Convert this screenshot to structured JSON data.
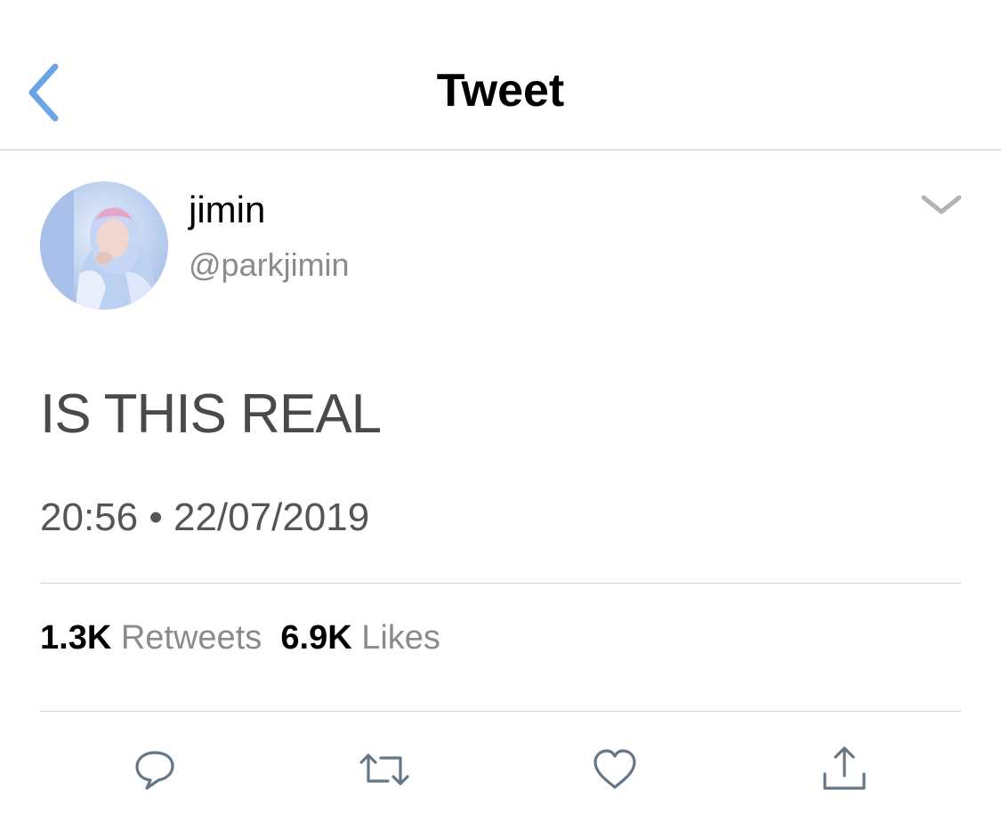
{
  "nav": {
    "title": "Tweet",
    "back_icon": "chevron-left-icon"
  },
  "colors": {
    "accent_blue": "#6aa6e6",
    "name_black": "#000000",
    "secondary_gray": "#8a8a8f",
    "divider_gray": "#d4d4d8",
    "action_icon_gray": "#657786"
  },
  "tweet": {
    "author": {
      "display_name": "jimin",
      "handle": "@parkjimin",
      "avatar_icon": "profile-photo"
    },
    "text": "IS THIS REAL",
    "time": "20:56",
    "separator": "•",
    "date": "22/07/2019",
    "stats": {
      "retweets_count": "1.3K",
      "retweets_label": "Retweets",
      "likes_count": "6.9K",
      "likes_label": "Likes"
    }
  },
  "actions": [
    {
      "name": "reply",
      "icon": "speech-bubble-icon"
    },
    {
      "name": "retweet",
      "icon": "retweet-arrows-icon"
    },
    {
      "name": "like",
      "icon": "heart-icon"
    },
    {
      "name": "share",
      "icon": "share-upload-icon"
    }
  ]
}
